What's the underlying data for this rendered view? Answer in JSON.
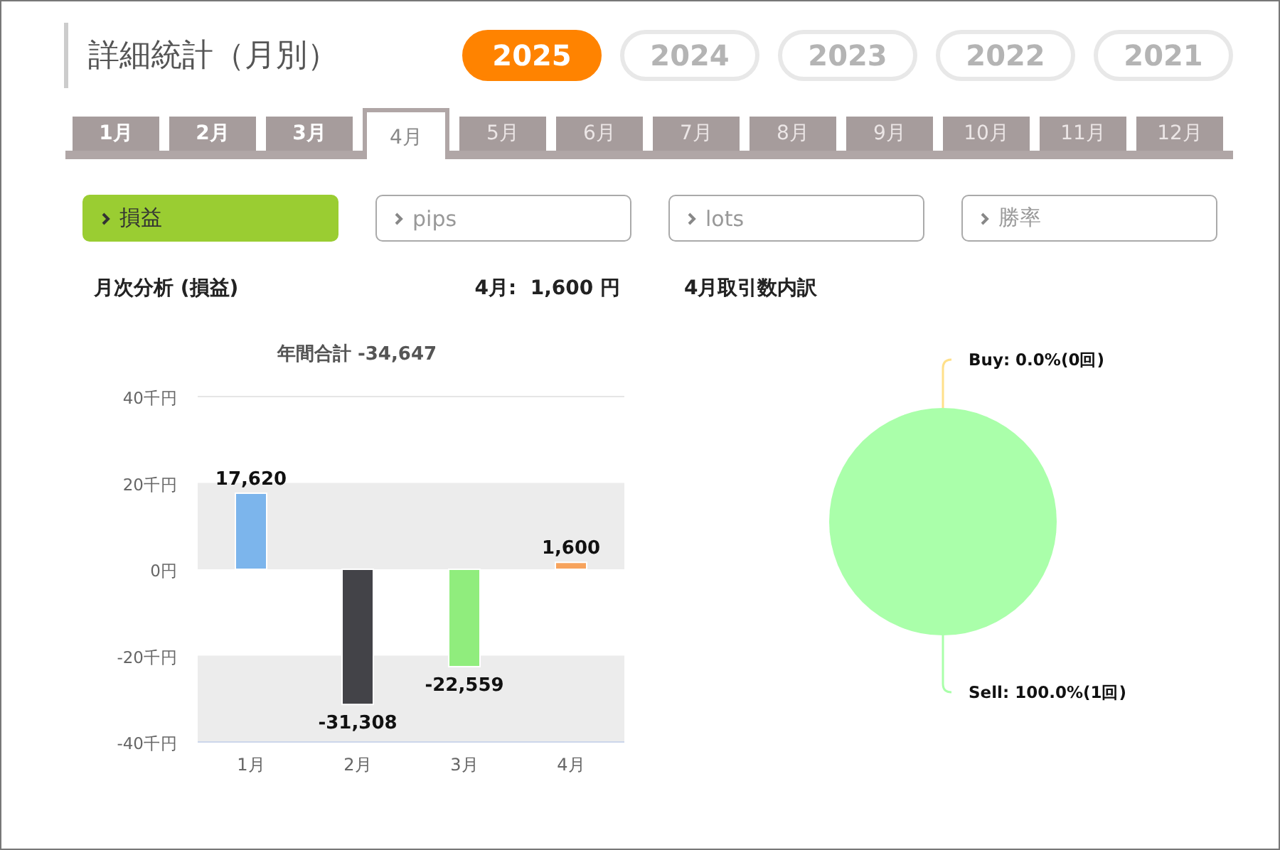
{
  "header": {
    "title": "詳細統計（月別）",
    "years": [
      {
        "label": "2025",
        "selected": true
      },
      {
        "label": "2024",
        "selected": false
      },
      {
        "label": "2023",
        "selected": false
      },
      {
        "label": "2022",
        "selected": false
      },
      {
        "label": "2021",
        "selected": false
      }
    ]
  },
  "month_tabs": [
    {
      "label": "1月",
      "selected": false,
      "disabled": false
    },
    {
      "label": "2月",
      "selected": false,
      "disabled": false
    },
    {
      "label": "3月",
      "selected": false,
      "disabled": false
    },
    {
      "label": "4月",
      "selected": true,
      "disabled": false
    },
    {
      "label": "5月",
      "selected": false,
      "disabled": true
    },
    {
      "label": "6月",
      "selected": false,
      "disabled": true
    },
    {
      "label": "7月",
      "selected": false,
      "disabled": true
    },
    {
      "label": "8月",
      "selected": false,
      "disabled": true
    },
    {
      "label": "9月",
      "selected": false,
      "disabled": true
    },
    {
      "label": "10月",
      "selected": false,
      "disabled": true
    },
    {
      "label": "11月",
      "selected": false,
      "disabled": true
    },
    {
      "label": "12月",
      "selected": false,
      "disabled": true
    }
  ],
  "metric_buttons": [
    {
      "label": "損益",
      "selected": true
    },
    {
      "label": "pips",
      "selected": false
    },
    {
      "label": "lots",
      "selected": false
    },
    {
      "label": "勝率",
      "selected": false
    }
  ],
  "headings": {
    "analysis": "月次分析 (損益)",
    "month_total": "4月:  1,600 円",
    "breakdown": "4月取引数内訳"
  },
  "monthly_chart": {
    "chart_data": {
      "type": "bar",
      "title": "年間合計 -34,647",
      "categories": [
        "1月",
        "2月",
        "3月",
        "4月"
      ],
      "values": [
        17.62,
        -31.308,
        -22.559,
        1.6
      ],
      "annotations": [
        {
          "x": "1月",
          "y": 17.62,
          "text": "17,620"
        },
        {
          "x": "2月",
          "y": -31.308,
          "text": "-31,308"
        },
        {
          "x": "3月",
          "y": -22.559,
          "text": "-22,559"
        },
        {
          "x": "4月",
          "y": 1.6,
          "text": "1,600"
        }
      ],
      "ylim": [
        -40,
        40
      ],
      "yticks": [
        {
          "value": 40,
          "label": "40千円"
        },
        {
          "value": 20,
          "label": "20千円"
        },
        {
          "value": 0,
          "label": "0円"
        },
        {
          "value": -20,
          "label": "-20千円"
        },
        {
          "value": -40,
          "label": "-40千円"
        }
      ]
    }
  },
  "breakdown_chart": {
    "chart_data": {
      "type": "pie",
      "categories": [
        "Buy: 0.0%(0回)",
        "Sell: 100.0%(1回)"
      ],
      "values": [
        0,
        100
      ]
    }
  }
}
